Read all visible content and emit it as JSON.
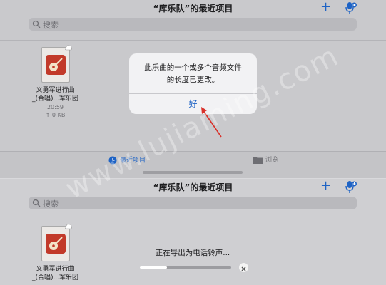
{
  "top_screen": {
    "title": "“库乐队”的最近项目",
    "search_placeholder": "搜索",
    "file": {
      "name_line1": "义勇军进行曲",
      "name_line2": "_(合唱)...军乐团",
      "time": "20:59",
      "size": "↑ 0 KB"
    },
    "tabs": [
      {
        "label": "最近项目",
        "icon": "clock-icon",
        "active": true
      },
      {
        "label": "浏览",
        "icon": "folder-icon",
        "active": false
      }
    ],
    "alert": {
      "message_line1": "此乐曲的一个或多个音频文件",
      "message_line2": "的长度已更改。",
      "ok_label": "好"
    }
  },
  "bottom_screen": {
    "title": "“库乐队”的最近项目",
    "search_placeholder": "搜索",
    "file": {
      "name_line1": "义勇军进行曲",
      "name_line2": "_(合唱)...军乐团"
    },
    "export": {
      "label": "正在导出为电话铃声...",
      "progress": 0.3
    }
  },
  "watermark": "www.lujiaming.com",
  "colors": {
    "accent": "#1e63c5",
    "annotation_arrow": "#d9322b"
  }
}
